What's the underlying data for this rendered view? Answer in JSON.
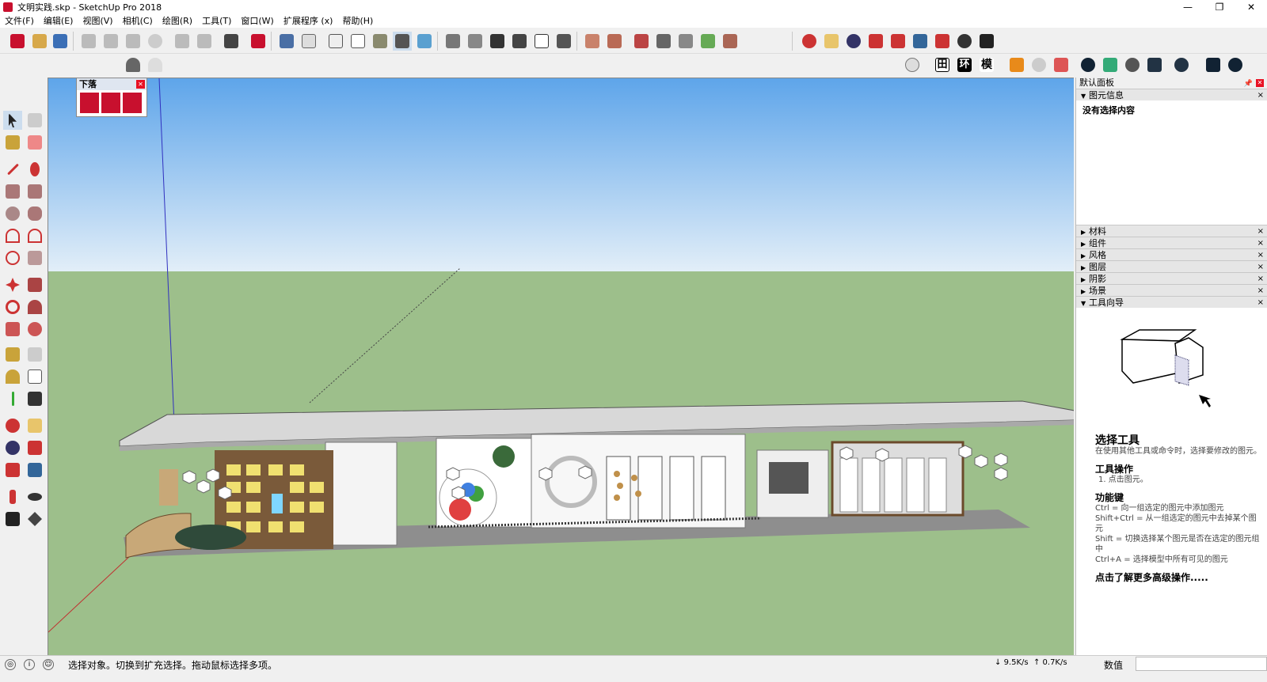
{
  "window": {
    "title": "文明实践.skp - SketchUp Pro 2018",
    "minimize": "—",
    "maximize": "❐",
    "close": "✕"
  },
  "menu": [
    "文件(F)",
    "编辑(E)",
    "视图(V)",
    "相机(C)",
    "绘图(R)",
    "工具(T)",
    "窗口(W)",
    "扩展程序 (x)",
    "帮助(H)"
  ],
  "float_panel": {
    "title": "下落"
  },
  "toolbar2_text_buttons": [
    "田",
    "环",
    "模"
  ],
  "tray": {
    "title": "默认面板",
    "entity_info": {
      "header": "图元信息",
      "body": "没有选择内容"
    },
    "panels": [
      "材料",
      "组件",
      "风格",
      "图层",
      "阴影",
      "场景"
    ],
    "instructor": {
      "header": "工具向导",
      "tool_name": "选择工具",
      "tool_desc": "在使用其他工具或命令时，选择要修改的图元。",
      "ops_title": "工具操作",
      "ops": [
        "1. 点击图元。"
      ],
      "keys_title": "功能键",
      "keys": [
        "Ctrl = 向一组选定的图元中添加图元",
        "Shift+Ctrl = 从一组选定的图元中去掉某个图元",
        "Shift = 切换选择某个图元是否在选定的图元组中",
        "Ctrl+A = 选择模型中所有可见的图元"
      ],
      "more": "点击了解更多高级操作....."
    }
  },
  "status": {
    "message": "选择对象。切换到扩充选择。拖动鼠标选择多项。",
    "down_speed": "9.5K/s",
    "up_speed": "0.7K/s",
    "value_label": "数值"
  },
  "colors": {
    "sky_top": "#5ea5ea",
    "sky_bottom": "#e2eef8",
    "ground": "#9dbf8b",
    "accent": "#c8102e"
  }
}
